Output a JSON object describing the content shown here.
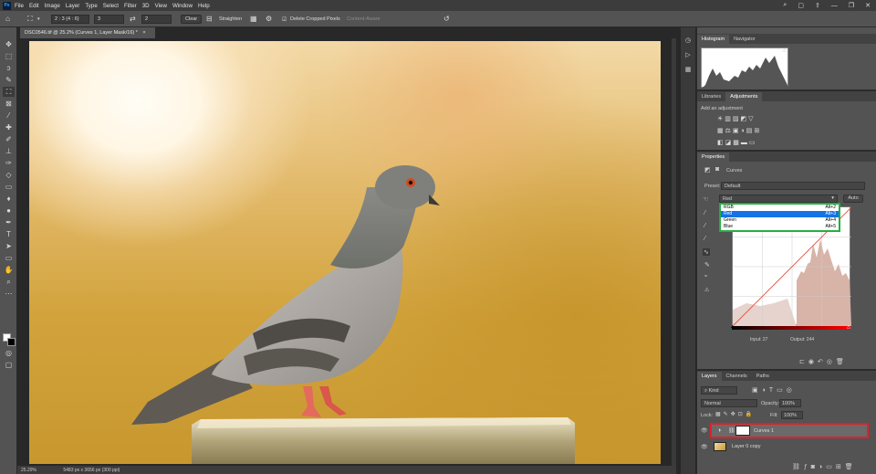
{
  "menu": {
    "app_icon": "Ps",
    "items": [
      "File",
      "Edit",
      "Image",
      "Layer",
      "Type",
      "Select",
      "Filter",
      "3D",
      "View",
      "Window",
      "Help"
    ]
  },
  "window_controls": {
    "search": "⌕",
    "workspace": "▢",
    "share": "⇪",
    "minimize": "—",
    "maximize": "❐",
    "close": "✕"
  },
  "options": {
    "ratio": "2 : 3 (4 : 6)",
    "width": "3",
    "height": "2",
    "clear": "Clear",
    "straighten": "Straighten",
    "delete_cropped": "Delete Cropped Pixels",
    "content_aware": "Content-Aware"
  },
  "document": {
    "tab": "DSC0546.tif @ 25.2% (Curves 1, Layer Mask/16) *",
    "zoom": "25.29%",
    "size": "5483 px x 3656 px (300 ppi)"
  },
  "panels": {
    "histogram_tabs": [
      "Histogram",
      "Navigator"
    ],
    "adjust_tabs": [
      "Libraries",
      "Adjustments"
    ],
    "add_adjustment": "Add an adjustment",
    "properties_tab": "Properties",
    "curves_label": "Curves",
    "preset_label": "Preset:",
    "preset_value": "Default",
    "channel_value": "Red",
    "auto": "Auto",
    "channels": [
      {
        "name": "RGB",
        "shortcut": "Alt+2"
      },
      {
        "name": "Red",
        "shortcut": "Alt+3"
      },
      {
        "name": "Green",
        "shortcut": "Alt+4"
      },
      {
        "name": "Blue",
        "shortcut": "Alt+5"
      }
    ],
    "input_label": "Input: 27",
    "output_label": "Output: 244",
    "layers_tabs": [
      "Layers",
      "Channels",
      "Paths"
    ],
    "kind": "Kind",
    "blend": "Normal",
    "opacity_label": "Opacity:",
    "opacity": "100%",
    "lock_label": "Lock:",
    "fill_label": "Fill:",
    "fill": "100%",
    "layers": [
      {
        "name": "Curves 1",
        "selected": true
      },
      {
        "name": "Layer 0 copy",
        "selected": false
      }
    ]
  },
  "colors": {
    "highlight_red": "#e0202a",
    "highlight_green": "#23b040",
    "selected_blue": "#1473e6"
  }
}
